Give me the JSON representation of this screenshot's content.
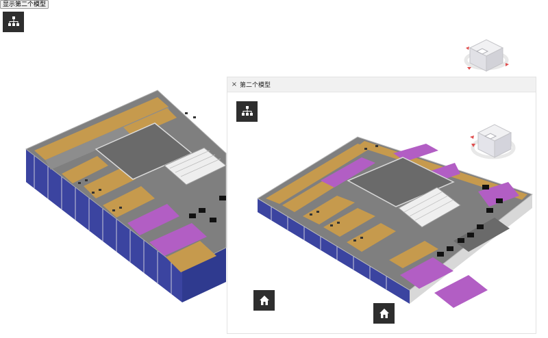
{
  "toolbar": {
    "show_second_model_label": "显示第二个模型"
  },
  "viewer_main": {
    "model_browser_icon": "hierarchy-icon",
    "viewcube_icon": "viewcube-icon"
  },
  "second_panel": {
    "close_label": "×",
    "title": "第二个模型",
    "model_browser_icon": "hierarchy-icon",
    "viewcube_icon": "viewcube-icon",
    "home_icon": "home-icon",
    "home_icon_2": "home-icon"
  },
  "colors": {
    "toolbar_button_bg": "#2e2e2e",
    "room_purple": "#b25ec4",
    "wall_tan": "#c69a4d",
    "floor_gray": "#7f7f7f",
    "facade_blue": "#2f3a8f"
  }
}
